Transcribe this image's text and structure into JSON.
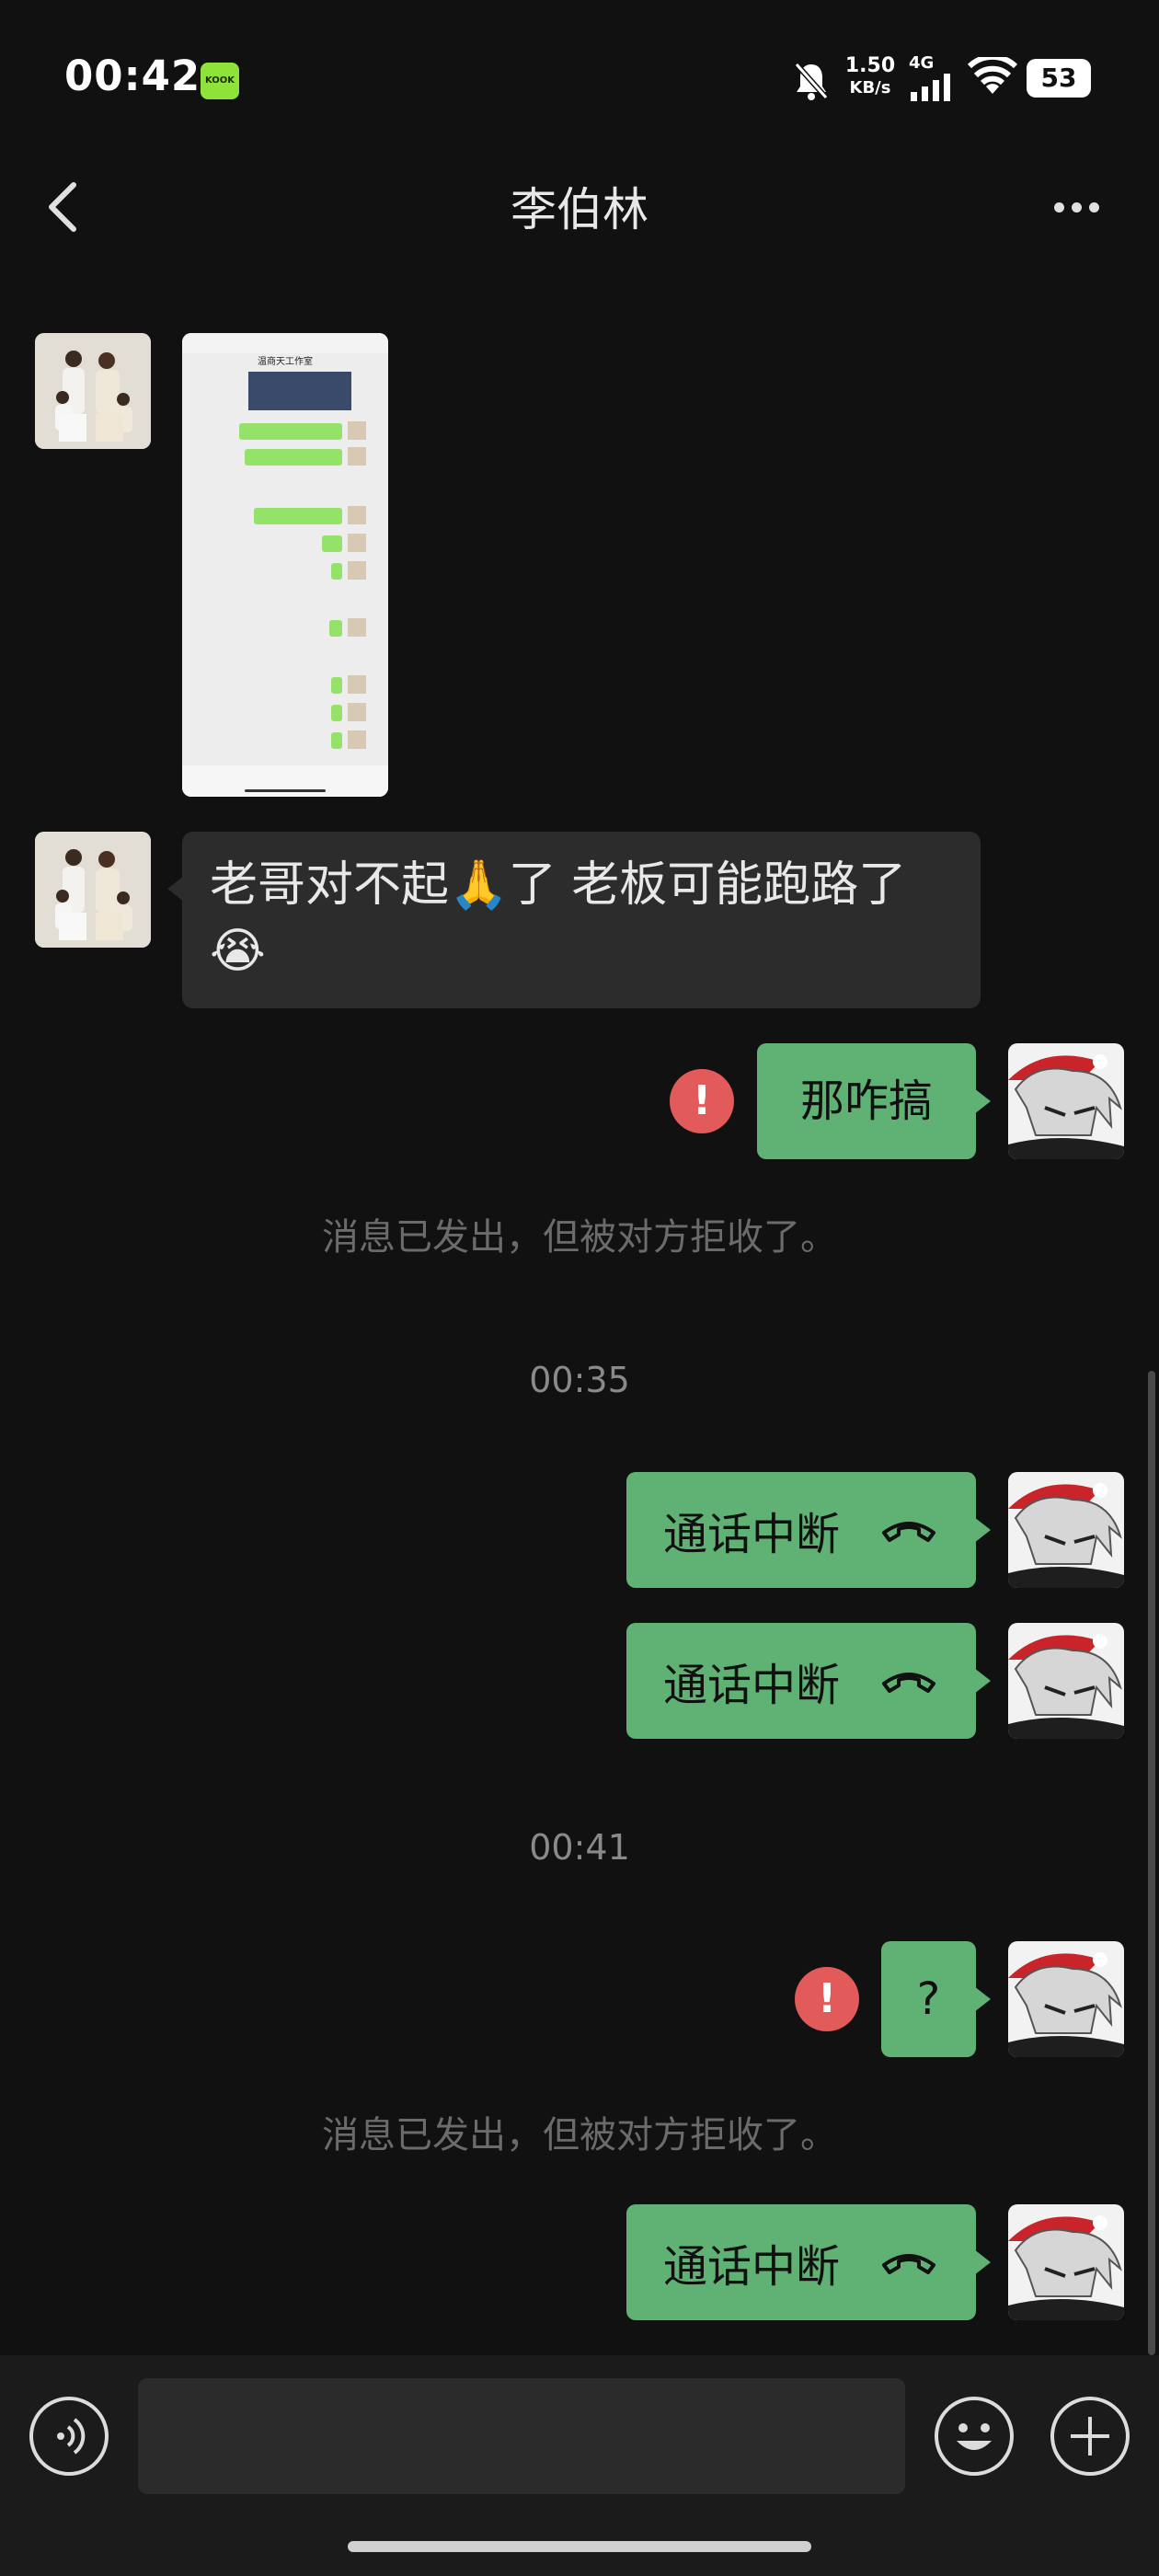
{
  "status_bar": {
    "time": "00:42",
    "app_badge": "KOOK",
    "net_speed_value": "1.50",
    "net_speed_unit": "KB/s",
    "network": "4G",
    "battery": "53"
  },
  "header": {
    "title": "李伯林"
  },
  "messages": {
    "screenshot_title": "温商天工作室",
    "incoming_text": "老哥对不起🙏了 老板可能跑路了😭",
    "msg1": "那咋搞",
    "rejected_note_1": "消息已发出，但被对方拒收了。",
    "time_1": "00:35",
    "call1": "通话中断",
    "call2": "通话中断",
    "time_2": "00:41",
    "msg2": "?",
    "rejected_note_2": "消息已发出，但被对方拒收了。",
    "call3": "通话中断",
    "error_mark": "!"
  },
  "colors": {
    "background": "#111111",
    "outgoing_bubble": "#5fb274",
    "incoming_bubble": "#2c2c2c",
    "error": "#e35a5a"
  },
  "icons": {
    "back": "chevron-left-icon",
    "more": "more-dots-icon",
    "voice": "voice-icon",
    "emoji": "emoji-icon",
    "plus": "plus-icon",
    "hangup": "phone-hangup-icon"
  }
}
